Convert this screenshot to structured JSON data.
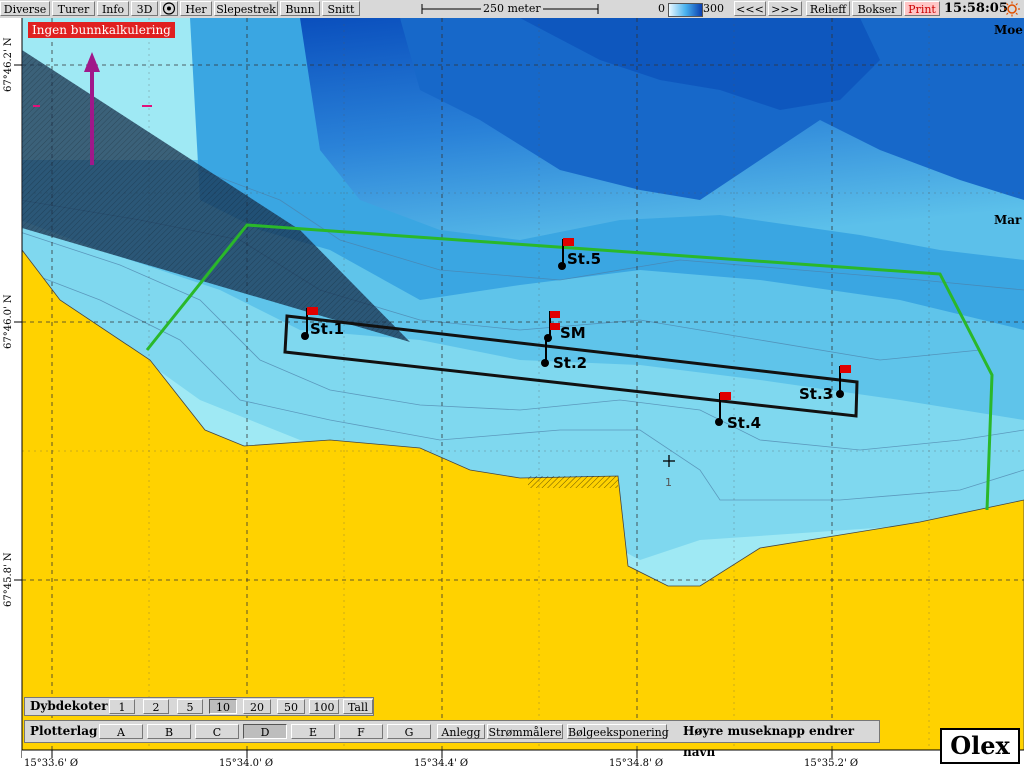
{
  "toolbar": {
    "items": [
      "Diverse",
      "Turer",
      "Info",
      "3D",
      "Her",
      "Slepestrek",
      "Bunn",
      "Snitt"
    ],
    "scale_label": "250 meter",
    "depth_min": "0",
    "depth_max": "300",
    "prev": "<<<",
    "next": ">>>",
    "relieff": "Relieff",
    "bokser": "Bokser",
    "print": "Print",
    "clock": "15:58:05"
  },
  "warning": "Ingen bunnkalkulering",
  "place_names": [
    "Moe",
    "Mar"
  ],
  "stations": [
    "St.1",
    "St.2",
    "St.3",
    "St.4",
    "St.5",
    "SM"
  ],
  "lat_labels": [
    "67°46.2' N",
    "67°46.0' N",
    "67°45.8' N"
  ],
  "lon_labels": [
    "15°33.6' Ø",
    "15°34.0' Ø",
    "15°34.4' Ø",
    "15°34.8' Ø",
    "15°35.2' Ø"
  ],
  "marker_number": "1",
  "dybdekoter": {
    "label": "Dybdekoter",
    "options": [
      "1",
      "2",
      "5",
      "10",
      "20",
      "50",
      "100",
      "Tall"
    ],
    "active": "10"
  },
  "plotterlag": {
    "label": "Plotterlag",
    "options": [
      "A",
      "B",
      "C",
      "D",
      "E",
      "F",
      "G"
    ],
    "active": "D",
    "extras": [
      "Anlegg",
      "Strømmålere",
      "Bølgeeksponering"
    ],
    "hint": "Høyre museknapp endrer navn"
  },
  "logo": "Olex",
  "colors": {
    "land": "#ffd200",
    "shallow": "#9fe9f4",
    "deep": "#0a4fbd",
    "track": "#2ab82a",
    "warning": "#e02020",
    "flag": "#e00000"
  }
}
